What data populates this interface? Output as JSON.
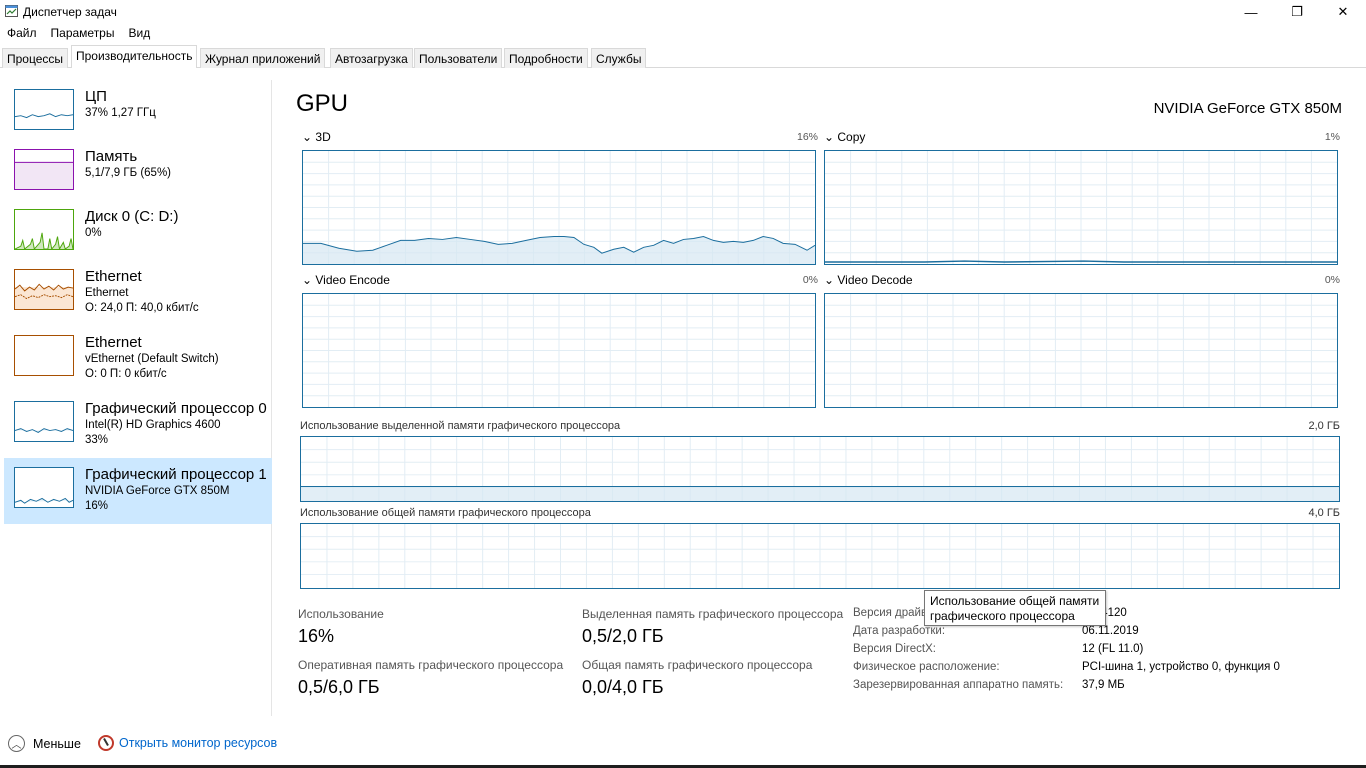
{
  "window": {
    "title": "Диспетчер задач",
    "controls": {
      "minimize": "—",
      "maximize": "❐",
      "close": "✕"
    }
  },
  "menu": [
    "Файл",
    "Параметры",
    "Вид"
  ],
  "tabs": [
    "Процессы",
    "Производительность",
    "Журнал приложений",
    "Автозагрузка",
    "Пользователи",
    "Подробности",
    "Службы"
  ],
  "active_tab": "Производительность",
  "sidebar": [
    {
      "title": "ЦП",
      "line1": "37% 1,27 ГГц",
      "line2": "",
      "color": "#1b6e9e"
    },
    {
      "title": "Память",
      "line1": "5,1/7,9 ГБ (65%)",
      "line2": "",
      "color": "#8b12ae"
    },
    {
      "title": "Диск 0 (C: D:)",
      "line1": "0%",
      "line2": "",
      "color": "#4da60c"
    },
    {
      "title": "Ethernet",
      "line1": "Ethernet",
      "line2": "О: 24,0 П: 40,0 кбит/с",
      "color": "#a74f01"
    },
    {
      "title": "Ethernet",
      "line1": "vEthernet (Default Switch)",
      "line2": "О: 0 П: 0 кбит/с",
      "color": "#a74f01"
    },
    {
      "title": "Графический процессор 0",
      "line1": "Intel(R) HD Graphics 4600",
      "line2": "33%",
      "color": "#1b6e9e"
    },
    {
      "title": "Графический процессор 1",
      "line1": "NVIDIA GeForce GTX 850M",
      "line2": "16%",
      "color": "#1b6e9e"
    }
  ],
  "main": {
    "title": "GPU",
    "model": "NVIDIA GeForce GTX 850M",
    "engines": [
      {
        "label": "3D",
        "pct": "16%"
      },
      {
        "label": "Copy",
        "pct": "1%"
      },
      {
        "label": "Video Encode",
        "pct": "0%"
      },
      {
        "label": "Video Decode",
        "pct": "0%"
      }
    ],
    "dedicated_mem": {
      "label": "Использование выделенной памяти графического процессора",
      "max": "2,0 ГБ"
    },
    "shared_mem": {
      "label": "Использование общей памяти графического процессора",
      "max": "4,0 ГБ"
    },
    "stats": {
      "usage_label": "Использование",
      "usage_value": "16%",
      "dedicated_label": "Выделенная память графического процессора",
      "dedicated_value": "0,5/2,0 ГБ",
      "ram_label": "Оперативная память графического процессора",
      "ram_value": "0,5/6,0 ГБ",
      "shared_label": "Общая память графического процессора",
      "shared_value": "0,0/4,0 ГБ"
    },
    "info": [
      {
        "label": "Версия драйвера:",
        "value": ".14.4120"
      },
      {
        "label": "Дата разработки:",
        "value": "06.11.2019"
      },
      {
        "label": "Версия DirectX:",
        "value": "12 (FL 11.0)"
      },
      {
        "label": "Физическое расположение:",
        "value": "PCI-шина 1, устройство 0, функция 0"
      },
      {
        "label": "Зарезервированная аппаратно память:",
        "value": "37,9 МБ"
      }
    ],
    "tooltip": [
      "Использование общей памяти",
      "графического процессора"
    ]
  },
  "footer": {
    "less_label": "Меньше",
    "monitor_label": "Открыть монитор ресурсов"
  },
  "colors": {
    "accent": "#1b6e9e",
    "selected": "#cce8ff",
    "link": "#0066cc"
  }
}
